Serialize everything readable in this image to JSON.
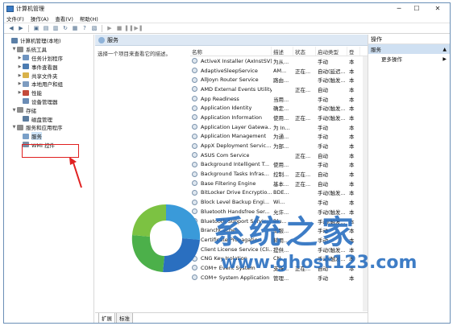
{
  "window": {
    "title": "计算机管理",
    "minimize": "─",
    "maximize": "☐",
    "close": "✕"
  },
  "menu": [
    "文件(F)",
    "操作(A)",
    "查看(V)",
    "帮助(H)"
  ],
  "tree": [
    {
      "label": "计算机管理(本地)",
      "indent": 0,
      "arrow": "",
      "color": "#5b7fa6"
    },
    {
      "label": "系统工具",
      "indent": 1,
      "arrow": "▼",
      "color": "#8d8d8d"
    },
    {
      "label": "任务计划程序",
      "indent": 2,
      "arrow": "▶",
      "color": "#6f94c0"
    },
    {
      "label": "事件查看器",
      "indent": 2,
      "arrow": "▶",
      "color": "#4c7cb2"
    },
    {
      "label": "共享文件夹",
      "indent": 2,
      "arrow": "▶",
      "color": "#d9b24a"
    },
    {
      "label": "本地用户和组",
      "indent": 2,
      "arrow": "▶",
      "color": "#7d9cc0"
    },
    {
      "label": "性能",
      "indent": 2,
      "arrow": "▶",
      "color": "#c44a3a"
    },
    {
      "label": "设备管理器",
      "indent": 2,
      "arrow": "",
      "color": "#6b8cb5"
    },
    {
      "label": "存储",
      "indent": 1,
      "arrow": "▼",
      "color": "#8d8d8d"
    },
    {
      "label": "磁盘管理",
      "indent": 2,
      "arrow": "",
      "color": "#5c7c9e"
    },
    {
      "label": "服务和应用程序",
      "indent": 1,
      "arrow": "▼",
      "color": "#8d8d8d"
    },
    {
      "label": "服务",
      "indent": 2,
      "arrow": "",
      "color": "#7aa0c8",
      "selected": true
    },
    {
      "label": "WMI 控件",
      "indent": 2,
      "arrow": "",
      "color": "#7a8ea4"
    }
  ],
  "center": {
    "header": "服务",
    "description": "选择一个项目来查看它的描述。",
    "columns": [
      "名称",
      "描述",
      "状态",
      "启动类型",
      "登"
    ],
    "rows": [
      [
        "ActiveX Installer (AxInstSV)",
        "为从...",
        "",
        "手动",
        "本"
      ],
      [
        "AdaptiveSleepService",
        "AM...",
        "正在...",
        "自动(延迟...",
        "本"
      ],
      [
        "AllJoyn Router Service",
        "路由...",
        "",
        "手动(触发...",
        "本"
      ],
      [
        "AMD External Events Utility",
        "",
        "正在...",
        "自动",
        "本"
      ],
      [
        "App Readiness",
        "当用...",
        "",
        "手动",
        "本"
      ],
      [
        "Application Identity",
        "确定...",
        "",
        "手动(触发...",
        "本"
      ],
      [
        "Application Information",
        "使用...",
        "正在...",
        "手动(触发...",
        "本"
      ],
      [
        "Application Layer Gatewa...",
        "为 In...",
        "",
        "手动",
        "本"
      ],
      [
        "Application Management",
        "为通...",
        "",
        "手动",
        "本"
      ],
      [
        "AppX Deployment Servic...",
        "为部...",
        "",
        "手动",
        "本"
      ],
      [
        "ASUS Com Service",
        "",
        "正在...",
        "自动",
        "本"
      ],
      [
        "Background Intelligent T...",
        "使用...",
        "",
        "手动",
        "本"
      ],
      [
        "Background Tasks Infras...",
        "控制...",
        "正在...",
        "自动",
        "本"
      ],
      [
        "Base Filtering Engine",
        "基本...",
        "正在...",
        "自动",
        "本"
      ],
      [
        "BitLocker Drive Encryptio...",
        "BDE...",
        "",
        "手动(触发...",
        "本"
      ],
      [
        "Block Level Backup Engi...",
        "Wi...",
        "",
        "手动",
        "本"
      ],
      [
        "Bluetooth Handsfree Ser...",
        "允许...",
        "",
        "手动(触发...",
        "本"
      ],
      [
        "Bluetooth Support Servic...",
        "Blu...",
        "",
        "手动(触发...",
        "本"
      ],
      [
        "BranchCache",
        "此服...",
        "",
        "手动",
        "本"
      ],
      [
        "Certificate Propagation",
        "将用...",
        "",
        "手动",
        "本"
      ],
      [
        "Client License Service (Cli...",
        "提供...",
        "",
        "手动(触发...",
        "本"
      ],
      [
        "CNG Key Isolation",
        "CN...",
        "",
        "手动(触发...",
        "本"
      ],
      [
        "COM+ Event System",
        "支持...",
        "正在...",
        "自动",
        "本"
      ],
      [
        "COM+ System Application",
        "管理...",
        "",
        "手动",
        "本"
      ]
    ],
    "tabs": [
      "扩展",
      "标准"
    ]
  },
  "actions": {
    "header": "操作",
    "section": "服务",
    "section_arrow": "▲",
    "more": "更多操作",
    "more_arrow": "▶"
  },
  "watermark": {
    "brand": "系统之家",
    "url": "www.ghost123.com"
  }
}
